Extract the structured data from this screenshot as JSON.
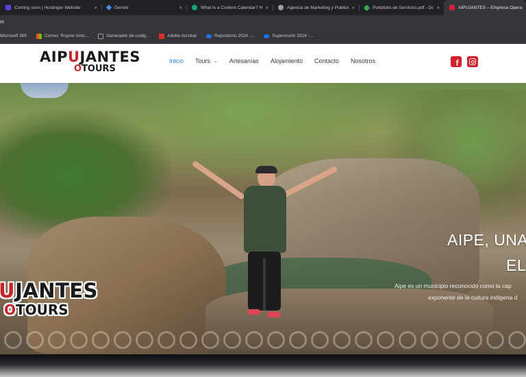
{
  "browser": {
    "tabs": [
      {
        "title": "Coming soon | Hostinger Website",
        "favicon_color": "#673de6"
      },
      {
        "title": "Gemini",
        "favicon_color": "#4a8af4"
      },
      {
        "title": "What Is a Content Calendar? How",
        "favicon_color": "#10a37f"
      },
      {
        "title": "Agencia de Marketing y Publicidad",
        "favicon_color": "#9aa0a6"
      },
      {
        "title": "Portafolio de Servicios.pdf - Goo",
        "favicon_color": "#34a853"
      },
      {
        "title": "AIPUJANTES – Empresa Operadora",
        "favicon_color": "#d1212e",
        "active": true
      }
    ],
    "address_fragment": "m",
    "bookmarks": [
      {
        "label": "Microsoft 365",
        "icon_color": "#3c3c3c"
      },
      {
        "label": "Correo: Roycer Anto...",
        "icon_color": "#f25022"
      },
      {
        "label": "Generador de codig...",
        "icon_color": "#5f6368"
      },
      {
        "label": "Adobe Acrobat",
        "icon_color": "#d93025"
      },
      {
        "label": "Repositorio 2024 -...",
        "icon_color": "#1a73e8"
      },
      {
        "label": "Supervisión 2024 -...",
        "icon_color": "#1a73e8"
      }
    ]
  },
  "site": {
    "logo": {
      "top_a": "AIP",
      "top_mark": "U",
      "top_b": "JANTES",
      "bottom_mark": "O",
      "bottom_b": "TOURS"
    },
    "nav": [
      {
        "label": "Inicio",
        "active": true
      },
      {
        "label": "Tours",
        "dropdown": true
      },
      {
        "label": "Artesanías"
      },
      {
        "label": "Alojamiento"
      },
      {
        "label": "Contacto"
      },
      {
        "label": "Nosotros"
      }
    ],
    "social": {
      "facebook_glyph": "f"
    },
    "accent_color": "#d1212e",
    "nav_active_color": "#2e7fd1"
  },
  "hero": {
    "title_line1": "AIPE, UNA",
    "title_line2": "EL",
    "desc_line1": "Aipe es un municipio reconocido como la cap",
    "desc_line2": "exponente de la cultura indígena d",
    "stamp": {
      "top_mark": "U",
      "top_b": "JANTES",
      "bottom_mark": "O",
      "bottom_b": "TOURS"
    }
  }
}
